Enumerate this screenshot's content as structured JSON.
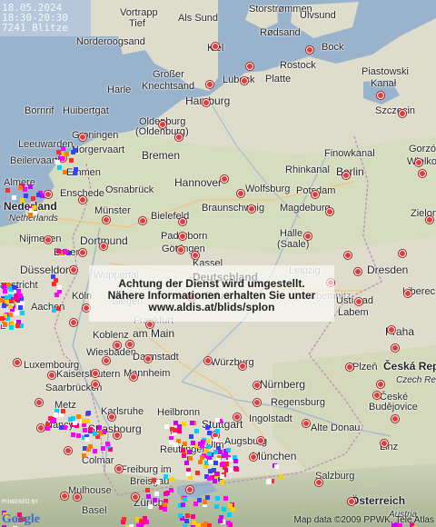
{
  "info": {
    "date": "18.05.2024",
    "time_range": "18:30-20:30",
    "count": "7241 Blitze"
  },
  "notice": {
    "line1": "Achtung der Dienst wird umgestellt.",
    "line2": "Nähere Informationen erhalten Sie unter",
    "line3": "www.aldis.at/blids/splon"
  },
  "footer": {
    "powered": "POWERED BY",
    "google": "Google",
    "copyright": "Map data ©2009 PPWK, Tele Atlas"
  },
  "labels": [
    {
      "name": "Vortrapp Tief",
      "text": "Vortrapp"
    },
    {
      "name": "Tief",
      "text": "Tief"
    },
    {
      "name": "Als Sund",
      "text": "Als Sund"
    },
    {
      "name": "Storstrommen",
      "text": "Storstrømmen"
    },
    {
      "name": "Ulvsund",
      "text": "Ulvsund"
    },
    {
      "name": "Rodsand",
      "text": "Rødsand"
    },
    {
      "name": "Norderoogsand",
      "text": "Norderoogsand"
    },
    {
      "name": "Kiel",
      "text": "Kiel"
    },
    {
      "name": "Bock",
      "text": "Bock"
    },
    {
      "name": "Grosser Knechtsand 1",
      "text": "Großer"
    },
    {
      "name": "Grosser Knechtsand 2",
      "text": "Knechtsand"
    },
    {
      "name": "Luebeck",
      "text": "Lübeck"
    },
    {
      "name": "Rostock",
      "text": "Rostock"
    },
    {
      "name": "Piastowski",
      "text": "Piastowski"
    },
    {
      "name": "Kanal",
      "text": "Kanał"
    },
    {
      "name": "Harle",
      "text": "Harle"
    },
    {
      "name": "Platte",
      "text": "Platte"
    },
    {
      "name": "Hamburg",
      "text": "Hamburg"
    },
    {
      "name": "Bornrif",
      "text": "Bornrif"
    },
    {
      "name": "Huibertgat",
      "text": "Huibertgat"
    },
    {
      "name": "Szczecin",
      "text": "Szczecin"
    },
    {
      "name": "Oldenburg",
      "text": "Oldenburg"
    },
    {
      "name": "Oldenburg2",
      "text": "(Oldenburg)"
    },
    {
      "name": "Groningen",
      "text": "Groningen"
    },
    {
      "name": "Leeuwarden",
      "text": "Leeuwarden"
    },
    {
      "name": "Norgervaart",
      "text": "Norgervaart"
    },
    {
      "name": "Bremen",
      "text": "Bremen"
    },
    {
      "name": "Finowkanal",
      "text": "Finowkanal"
    },
    {
      "name": "Gorzow",
      "text": "Gorzów"
    },
    {
      "name": "Wielkopolski",
      "text": "Wielkopolski"
    },
    {
      "name": "Beilervaart",
      "text": "Beilervaart"
    },
    {
      "name": "Emmen",
      "text": "Emmen"
    },
    {
      "name": "Rhinkanal",
      "text": "Rhinkanal"
    },
    {
      "name": "Berlin",
      "text": "Berlin"
    },
    {
      "name": "Almere",
      "text": "Almere"
    },
    {
      "name": "Hannover",
      "text": "Hannover"
    },
    {
      "name": "Osnabrueck",
      "text": "Osnabrück"
    },
    {
      "name": "Wolfsburg",
      "text": "Wolfsburg"
    },
    {
      "name": "Potsdam",
      "text": "Potsdam"
    },
    {
      "name": "Enschede",
      "text": "Enschede"
    },
    {
      "name": "Nederland",
      "text": "Nederland"
    },
    {
      "name": "Netherlands",
      "text": "Netherlands"
    },
    {
      "name": "Muenster",
      "text": "Münster"
    },
    {
      "name": "Braunschweig",
      "text": "Braunschweig"
    },
    {
      "name": "Magdeburg",
      "text": "Magdeburg"
    },
    {
      "name": "Bielefeld",
      "text": "Bielefeld"
    },
    {
      "name": "Zielona",
      "text": "Zielona"
    },
    {
      "name": "Nijmegen",
      "text": "Nijmegen"
    },
    {
      "name": "Paderborn",
      "text": "Paderborn"
    },
    {
      "name": "Halle",
      "text": "Halle"
    },
    {
      "name": "Saale",
      "text": "(Saale)"
    },
    {
      "name": "Dortmund",
      "text": "Dortmund"
    },
    {
      "name": "Goettingen",
      "text": "Göttingen"
    },
    {
      "name": "Essen",
      "text": "Essen"
    },
    {
      "name": "Kassel",
      "text": "Kassel"
    },
    {
      "name": "Leipzig",
      "text": "Leipzig"
    },
    {
      "name": "Duesseldorf",
      "text": "Düsseldorf"
    },
    {
      "name": "Wuppertal",
      "text": "Wuppertal"
    },
    {
      "name": "Deutschland",
      "text": "Deutschland"
    },
    {
      "name": "Dresden",
      "text": "Dresden"
    },
    {
      "name": "Maastricht",
      "text": "aastricht"
    },
    {
      "name": "Koeln",
      "text": "Köln"
    },
    {
      "name": "Erfurt",
      "text": "Erfurt"
    },
    {
      "name": "Chemnitz",
      "text": "Chemnitz"
    },
    {
      "name": "Liberec",
      "text": "Liberec"
    },
    {
      "name": "Aachen",
      "text": "Aachen"
    },
    {
      "name": "Siegen",
      "text": "Siegen"
    },
    {
      "name": "Usti",
      "text": "Ústí nad"
    },
    {
      "name": "Labem",
      "text": "Labem"
    },
    {
      "name": "Frankfurt",
      "text": "Frankfurt"
    },
    {
      "name": "Koblenz",
      "text": "Koblenz"
    },
    {
      "name": "amMain",
      "text": "am Main"
    },
    {
      "name": "Praha",
      "text": "Praha"
    },
    {
      "name": "Wiesbaden",
      "text": "Wiesbaden"
    },
    {
      "name": "Luxembourg",
      "text": "Luxembourg"
    },
    {
      "name": "Darmstadt",
      "text": "Darmstadt"
    },
    {
      "name": "Wuerzburg",
      "text": "Würzburg"
    },
    {
      "name": "Plzen",
      "text": "Plzeň"
    },
    {
      "name": "CeskaRep",
      "text": "Česká Rep"
    },
    {
      "name": "Kaiserslautern",
      "text": "Kaiserslautern"
    },
    {
      "name": "Mannheim",
      "text": "Mannheim"
    },
    {
      "name": "CzechRep",
      "text": "Czech Rep"
    },
    {
      "name": "Saarbruecken",
      "text": "Saarbrücken"
    },
    {
      "name": "Nuernberg",
      "text": "Nürnberg"
    },
    {
      "name": "Metz",
      "text": "Metz"
    },
    {
      "name": "Karlsruhe",
      "text": "Karlsruhe"
    },
    {
      "name": "Regensburg",
      "text": "Regensburg"
    },
    {
      "name": "Ceske",
      "text": "České"
    },
    {
      "name": "Budejovice",
      "text": "Budějovice"
    },
    {
      "name": "Heilbronn",
      "text": "Heilbronn"
    },
    {
      "name": "Nancy",
      "text": "Nancy"
    },
    {
      "name": "Strasbourg",
      "text": "Strasbourg"
    },
    {
      "name": "Stuttgart",
      "text": "Stuttgart"
    },
    {
      "name": "Ingolstadt",
      "text": "Ingolstadt"
    },
    {
      "name": "AlteDonau",
      "text": "Alte Donau"
    },
    {
      "name": "Linz",
      "text": "Linz"
    },
    {
      "name": "Augsburg",
      "text": "Augsburg"
    },
    {
      "name": "Reutlingen",
      "text": "Reutlingen"
    },
    {
      "name": "Colmar",
      "text": "Colmar"
    },
    {
      "name": "Ulm",
      "text": "Ulm"
    },
    {
      "name": "Muenchen",
      "text": "München"
    },
    {
      "name": "Freiburg",
      "text": "Freiburg im"
    },
    {
      "name": "Breisgau",
      "text": "Breisgau"
    },
    {
      "name": "Salzburg",
      "text": "Salzburg"
    },
    {
      "name": "Mulhouse",
      "text": "Mulhouse"
    },
    {
      "name": "Basel",
      "text": "Basel"
    },
    {
      "name": "Zuerich",
      "text": "Zürich"
    },
    {
      "name": "Oesterreich",
      "text": "Österreich"
    },
    {
      "name": "Austria",
      "text": "Austria"
    }
  ]
}
